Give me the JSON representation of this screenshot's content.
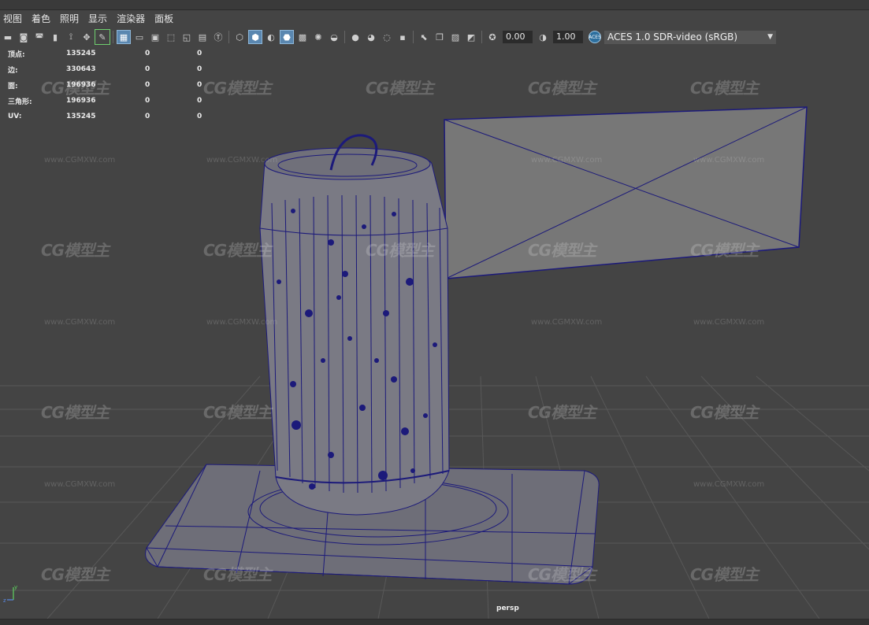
{
  "menu": [
    "视图",
    "着色",
    "照明",
    "显示",
    "渲染器",
    "面板"
  ],
  "toolbar": {
    "exposure": "0.00",
    "gamma": "1.00",
    "color_space": "ACES 1.0 SDR-video (sRGB)",
    "color_space_badge": "ACES"
  },
  "hud": {
    "rows": [
      {
        "label": "顶点:",
        "v1": "135245",
        "v2": "0",
        "v3": "0"
      },
      {
        "label": "边:",
        "v1": "330643",
        "v2": "0",
        "v3": "0"
      },
      {
        "label": "面:",
        "v1": "196936",
        "v2": "0",
        "v3": "0"
      },
      {
        "label": "三角形:",
        "v1": "196936",
        "v2": "0",
        "v3": "0"
      },
      {
        "label": "UV:",
        "v1": "135245",
        "v2": "0",
        "v3": "0"
      }
    ]
  },
  "viewport": {
    "camera": "persp",
    "watermark_logo": "CG模型主",
    "watermark_url": "www.CGMXW.com",
    "wire_color": "#1c1a7a",
    "grid_color": "#5a5a5a",
    "background": "#444444"
  },
  "axis": {
    "y": "y",
    "z": "z"
  }
}
